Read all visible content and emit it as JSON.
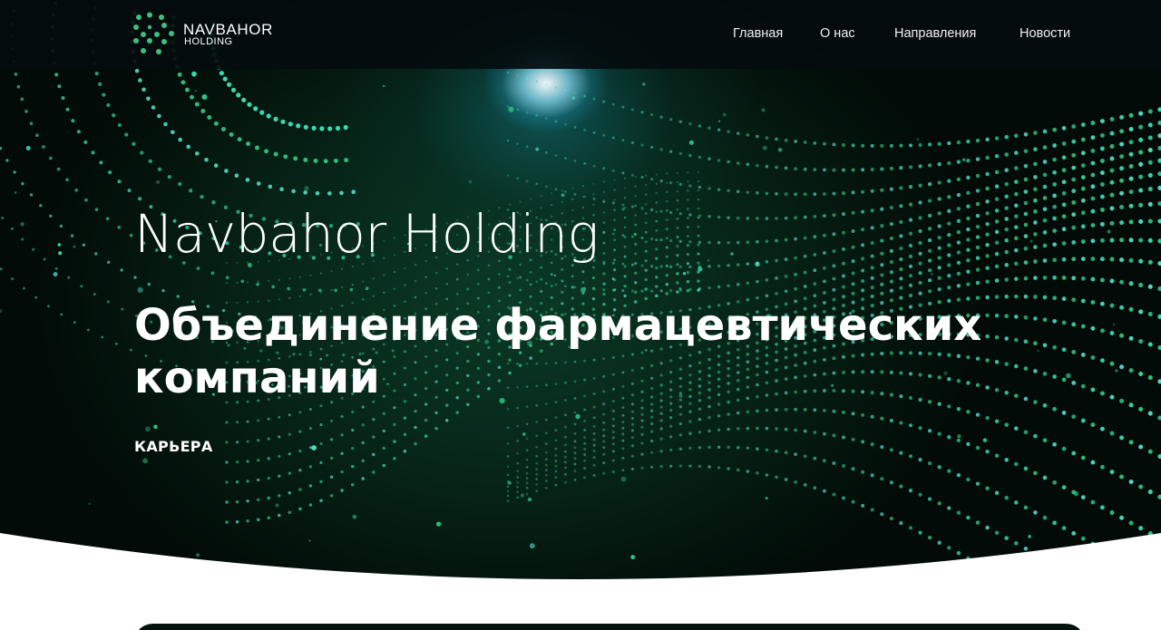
{
  "header": {
    "logo": {
      "name": "NAVBAHOR",
      "sub": "HOLDING",
      "icon": "dots-logo-icon",
      "color": "#3fbf7f"
    },
    "nav": [
      {
        "label": "Главная"
      },
      {
        "label": "О нас"
      },
      {
        "label": "Направления"
      },
      {
        "label": "Новости"
      }
    ]
  },
  "hero": {
    "title": "Navbahor Holding",
    "subtitle": "Объединение  фармацевтических компаний",
    "career_link": "КАРЬЕРА",
    "colors": {
      "accent": "#2fe0a8",
      "background": "#041a10",
      "glow": "#bff3ff"
    }
  }
}
